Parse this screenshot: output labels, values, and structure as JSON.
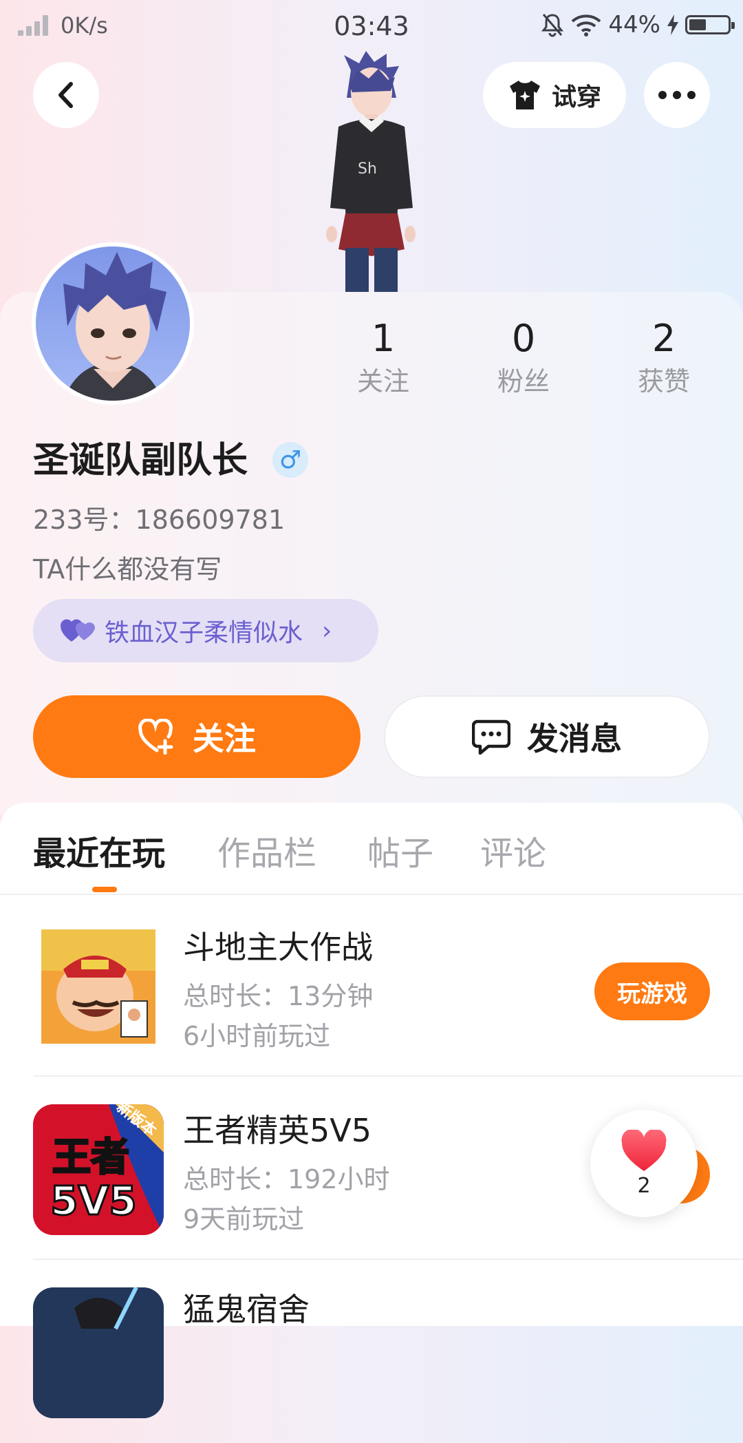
{
  "status_bar": {
    "net_speed": "0K/s",
    "time": "03:43",
    "battery": "44%",
    "battery_level": 0.44
  },
  "header": {
    "try_on_label": "试穿"
  },
  "profile": {
    "stats": [
      {
        "value": "1",
        "label": "关注"
      },
      {
        "value": "0",
        "label": "粉丝"
      },
      {
        "value": "2",
        "label": "获赞"
      }
    ],
    "username": "圣诞队副队长",
    "gender_symbol": "♂",
    "account_line": "233号：186609781",
    "bio": "TA什么都没有写",
    "tag": "铁血汉子柔情似水",
    "tag_chevron": "›",
    "follow_label": "关注",
    "message_label": "发消息"
  },
  "tabs": [
    "最近在玩",
    "作品栏",
    "帖子",
    "评论"
  ],
  "games": [
    {
      "title": "斗地主大作战",
      "duration": "总时长：13分钟",
      "last_played": "6小时前玩过",
      "action": "玩游戏"
    },
    {
      "title": "王者精英5V5",
      "duration": "总时长：192小时",
      "last_played": "9天前玩过",
      "icon_text": "王者",
      "icon_text2": "5V5",
      "icon_ribbon": "新版本"
    },
    {
      "title": "猛鬼宿舍"
    }
  ],
  "like_float": {
    "count": "2"
  },
  "colors": {
    "accent": "#ff7a12",
    "tag_text": "#6a5fd0",
    "tag_bg": "#e4dff5",
    "gender": "#3d95e8"
  }
}
